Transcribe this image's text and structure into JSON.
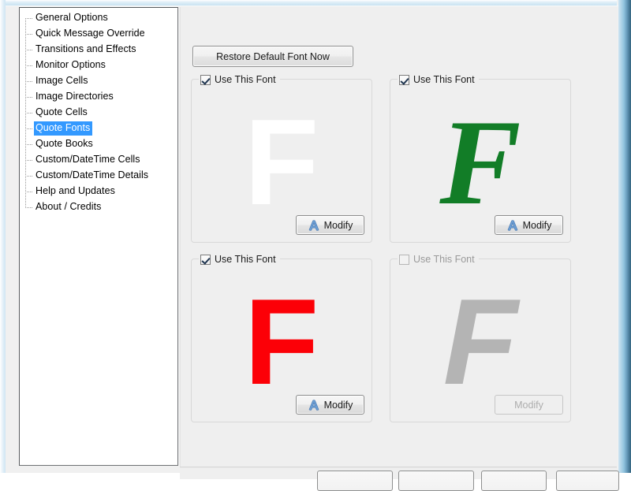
{
  "window": {
    "background_color": "#f0f0f0",
    "frame_accent_color": "#5f93b3"
  },
  "sidebar": {
    "name": "options-tree",
    "selected_index": 7,
    "selection_color": "#3399ff",
    "items": [
      {
        "label": "General Options"
      },
      {
        "label": "Quick Message Override"
      },
      {
        "label": "Transitions and Effects"
      },
      {
        "label": "Monitor Options"
      },
      {
        "label": "Image Cells"
      },
      {
        "label": "Image Directories"
      },
      {
        "label": "Quote Cells"
      },
      {
        "label": "Quote Fonts"
      },
      {
        "label": "Quote Books"
      },
      {
        "label": "Custom/DateTime Cells"
      },
      {
        "label": "Custom/DateTime Details"
      },
      {
        "label": "Help and Updates"
      },
      {
        "label": "About / Credits"
      }
    ]
  },
  "main": {
    "restore_button_label": "Restore Default Font Now",
    "font_slots": [
      {
        "id": "font-slot-1",
        "checkbox_label": "Use This Font",
        "checked": true,
        "enabled": true,
        "preview_char": "F",
        "preview_color": "#ffffff",
        "preview_style": "bold sans-serif",
        "modify_label": "Modify",
        "modify_icon": "font-a-icon"
      },
      {
        "id": "font-slot-2",
        "checkbox_label": "Use This Font",
        "checked": true,
        "enabled": true,
        "preview_char": "F",
        "preview_color": "#127d27",
        "preview_style": "bold italic serif",
        "modify_label": "Modify",
        "modify_icon": "font-a-icon"
      },
      {
        "id": "font-slot-3",
        "checkbox_label": "Use This Font",
        "checked": true,
        "enabled": true,
        "preview_char": "F",
        "preview_color": "#fc0007",
        "preview_style": "bold sans-serif",
        "modify_label": "Modify",
        "modify_icon": "font-a-icon"
      },
      {
        "id": "font-slot-4",
        "checkbox_label": "Use This Font",
        "checked": false,
        "enabled": false,
        "preview_char": "F",
        "preview_color": "#b4b4b4",
        "preview_style": "bold italic sans-serif",
        "modify_label": "Modify",
        "modify_icon": "none"
      }
    ]
  },
  "footer": {
    "buttons": [
      {
        "name": "footer-button-1"
      },
      {
        "name": "footer-button-2"
      },
      {
        "name": "footer-button-3"
      },
      {
        "name": "footer-button-4"
      }
    ]
  }
}
